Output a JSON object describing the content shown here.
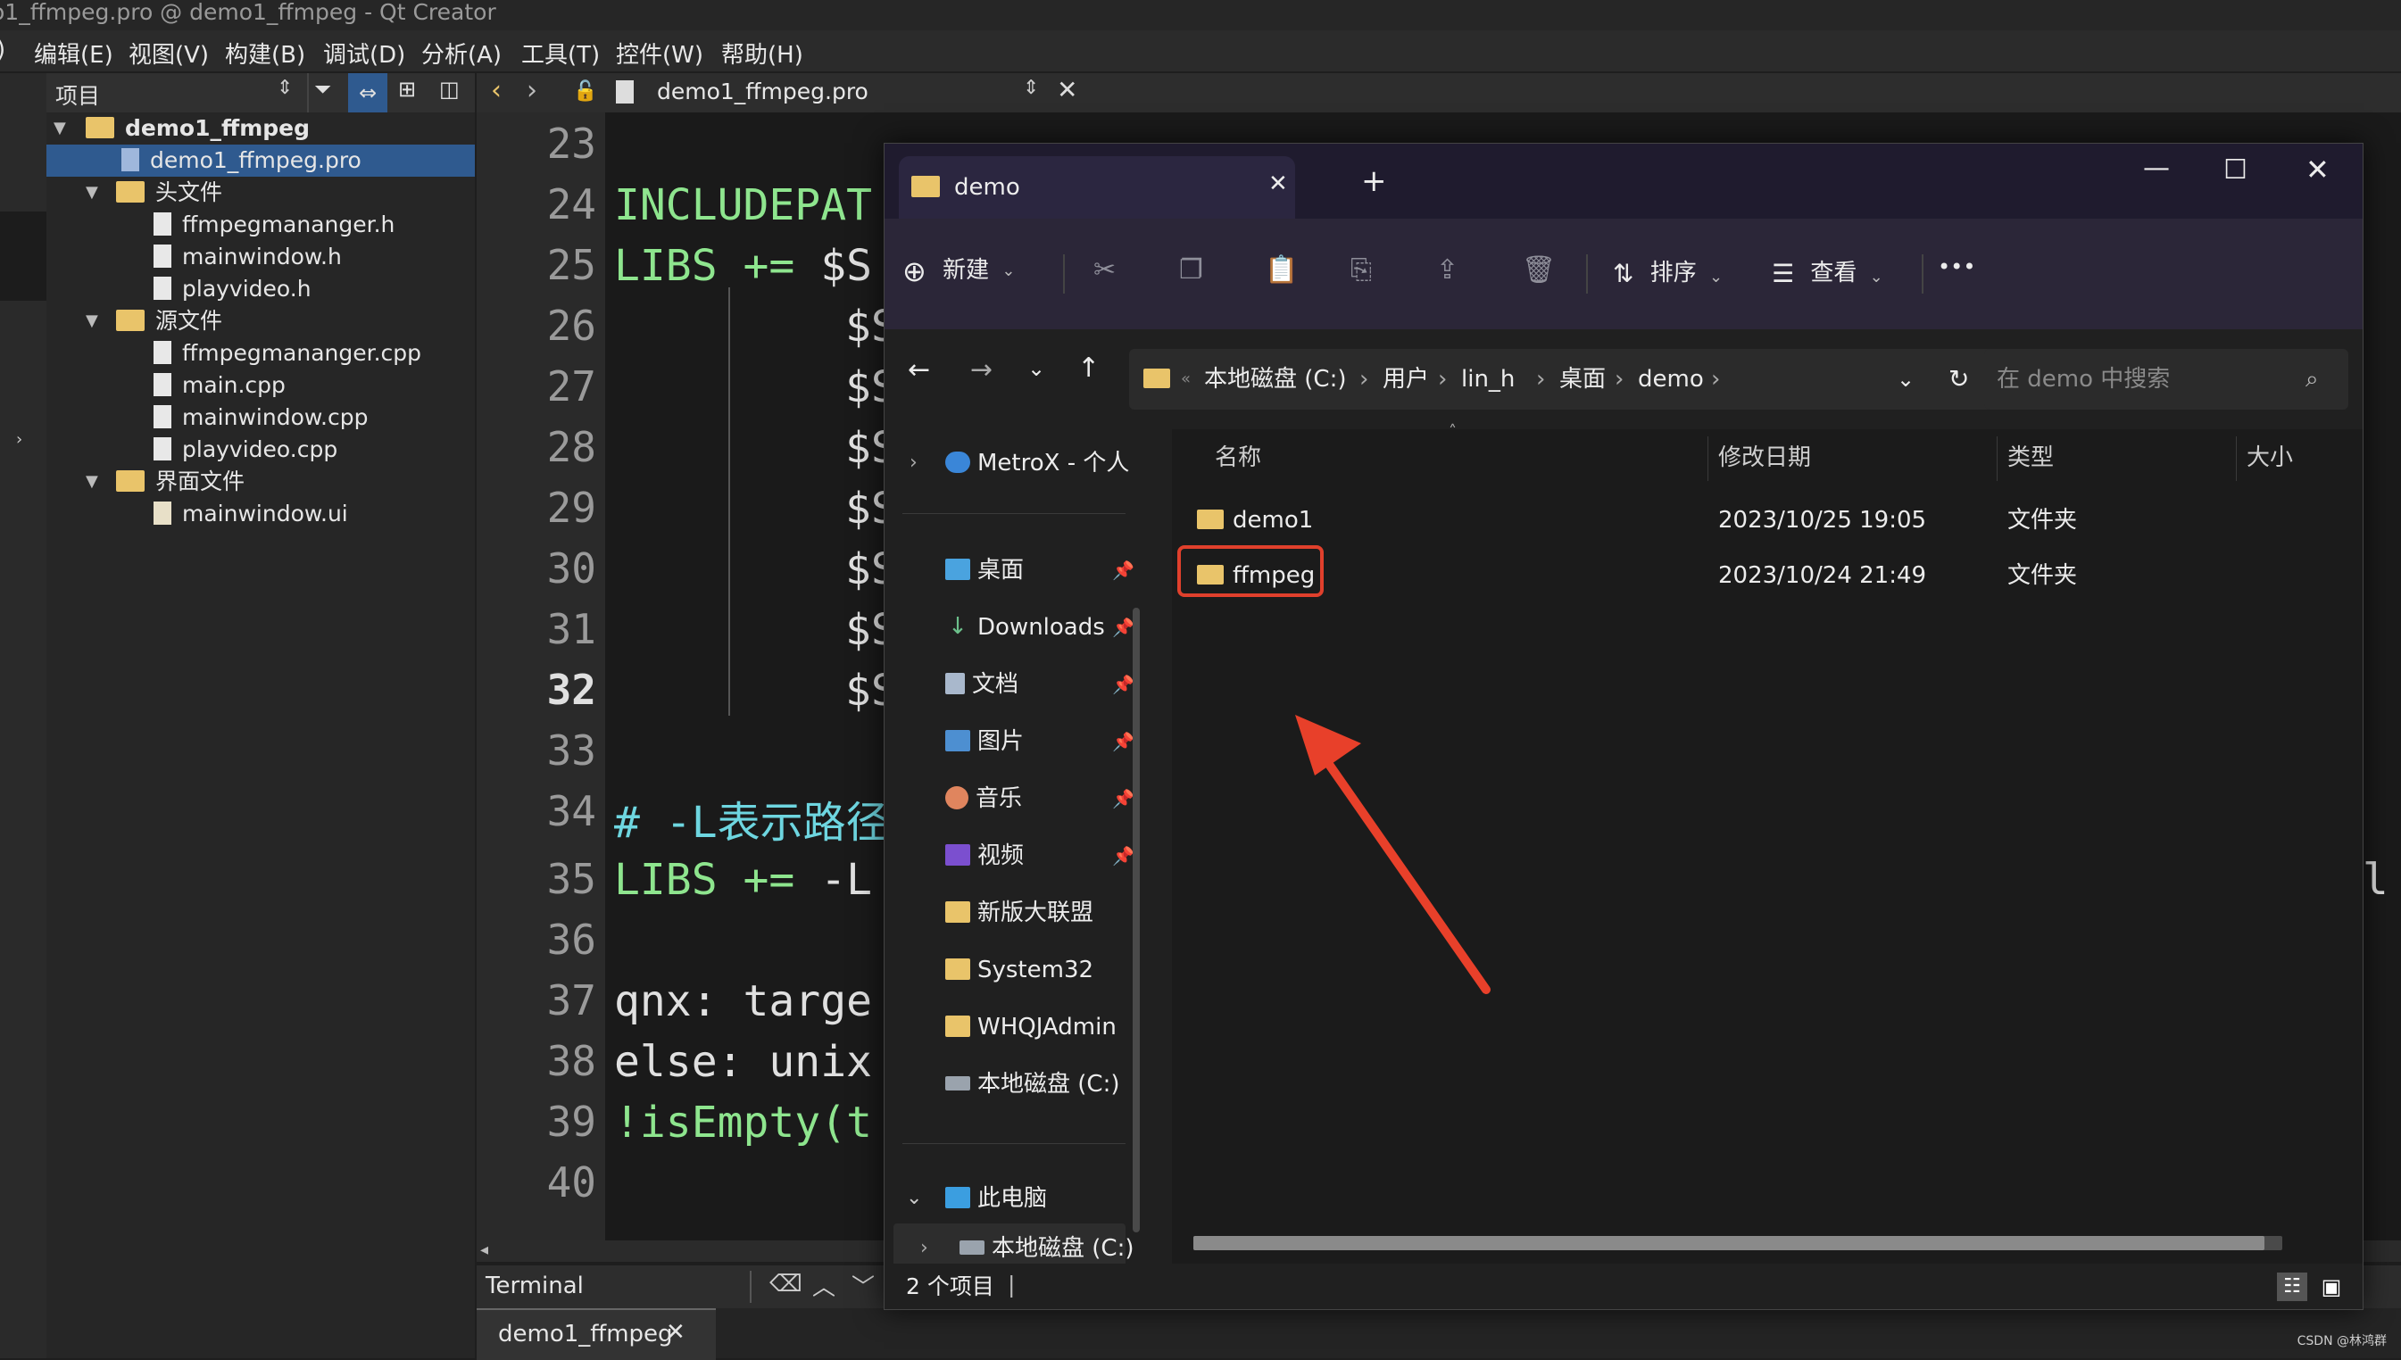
{
  "window_title": "o1_ffmpeg.pro @ demo1_ffmpeg - Qt Creator",
  "menu": [
    "编辑(E)",
    "视图(V)",
    "构建(B)",
    "调试(D)",
    "分析(A)",
    "工具(T)",
    "控件(W)",
    "帮助(H)"
  ],
  "menu_prefix": ")",
  "project_panel": {
    "title": "项目",
    "tree": {
      "root": "demo1_ffmpeg",
      "pro_file": "demo1_ffmpeg.pro",
      "headers_folder": "头文件",
      "headers": [
        "ffmpegmananger.h",
        "mainwindow.h",
        "playvideo.h"
      ],
      "sources_folder": "源文件",
      "sources": [
        "ffmpegmananger.cpp",
        "main.cpp",
        "mainwindow.cpp",
        "playvideo.cpp"
      ],
      "forms_folder": "界面文件",
      "forms": [
        "mainwindow.ui"
      ]
    }
  },
  "editor": {
    "open_file": "demo1_ffmpeg.pro",
    "line_numbers": [
      "23",
      "24",
      "25",
      "26",
      "27",
      "28",
      "29",
      "30",
      "31",
      "32",
      "33",
      "34",
      "35",
      "36",
      "37",
      "38",
      "39",
      "40"
    ],
    "current_line": "32",
    "lines": {
      "l24": "INCLUDEPAT",
      "l25a": "LIBS += ",
      "l25b": "$S",
      "cont": "$S",
      "l34": "# -L表示路径",
      "l35a": "LIBS += ",
      "l35b": "-L",
      "l35tail": "-l",
      "l37": "qnx: targe",
      "l38": "else: unix",
      "l39": "!isEmpty(t"
    }
  },
  "bottom": {
    "terminal_label": "Terminal",
    "tab_label": "demo1_ffmpeg"
  },
  "explorer": {
    "tab_title": "demo",
    "toolbar": {
      "new_label": "新建",
      "sort_label": "排序",
      "view_label": "查看",
      "more_label": "•••"
    },
    "breadcrumb": [
      "本地磁盘 (C:)",
      "用户",
      "lin_h",
      "桌面",
      "demo"
    ],
    "search_placeholder": "在 demo 中搜索",
    "nav": {
      "onedrive": "MetroX - 个人",
      "quick": [
        "桌面",
        "Downloads",
        "文档",
        "图片",
        "音乐",
        "视频",
        "新版大联盟",
        "System32",
        "WHQJAdmin",
        "本地磁盘 (C:)"
      ],
      "this_pc": "此电脑",
      "drive": "本地磁盘 (C:)"
    },
    "columns": [
      "名称",
      "修改日期",
      "类型",
      "大小"
    ],
    "files": [
      {
        "name": "demo1",
        "modified": "2023/10/25 19:05",
        "type": "文件夹"
      },
      {
        "name": "ffmpeg",
        "modified": "2023/10/24 21:49",
        "type": "文件夹"
      }
    ],
    "status": "2 个项目",
    "status_sep": "|"
  },
  "watermark": "CSDN @林鸿群",
  "colors": {
    "highlight_box": "#e0402c",
    "arrow": "#e8402a",
    "selection": "#2f5a8f",
    "code_green": "#8ee58e"
  }
}
